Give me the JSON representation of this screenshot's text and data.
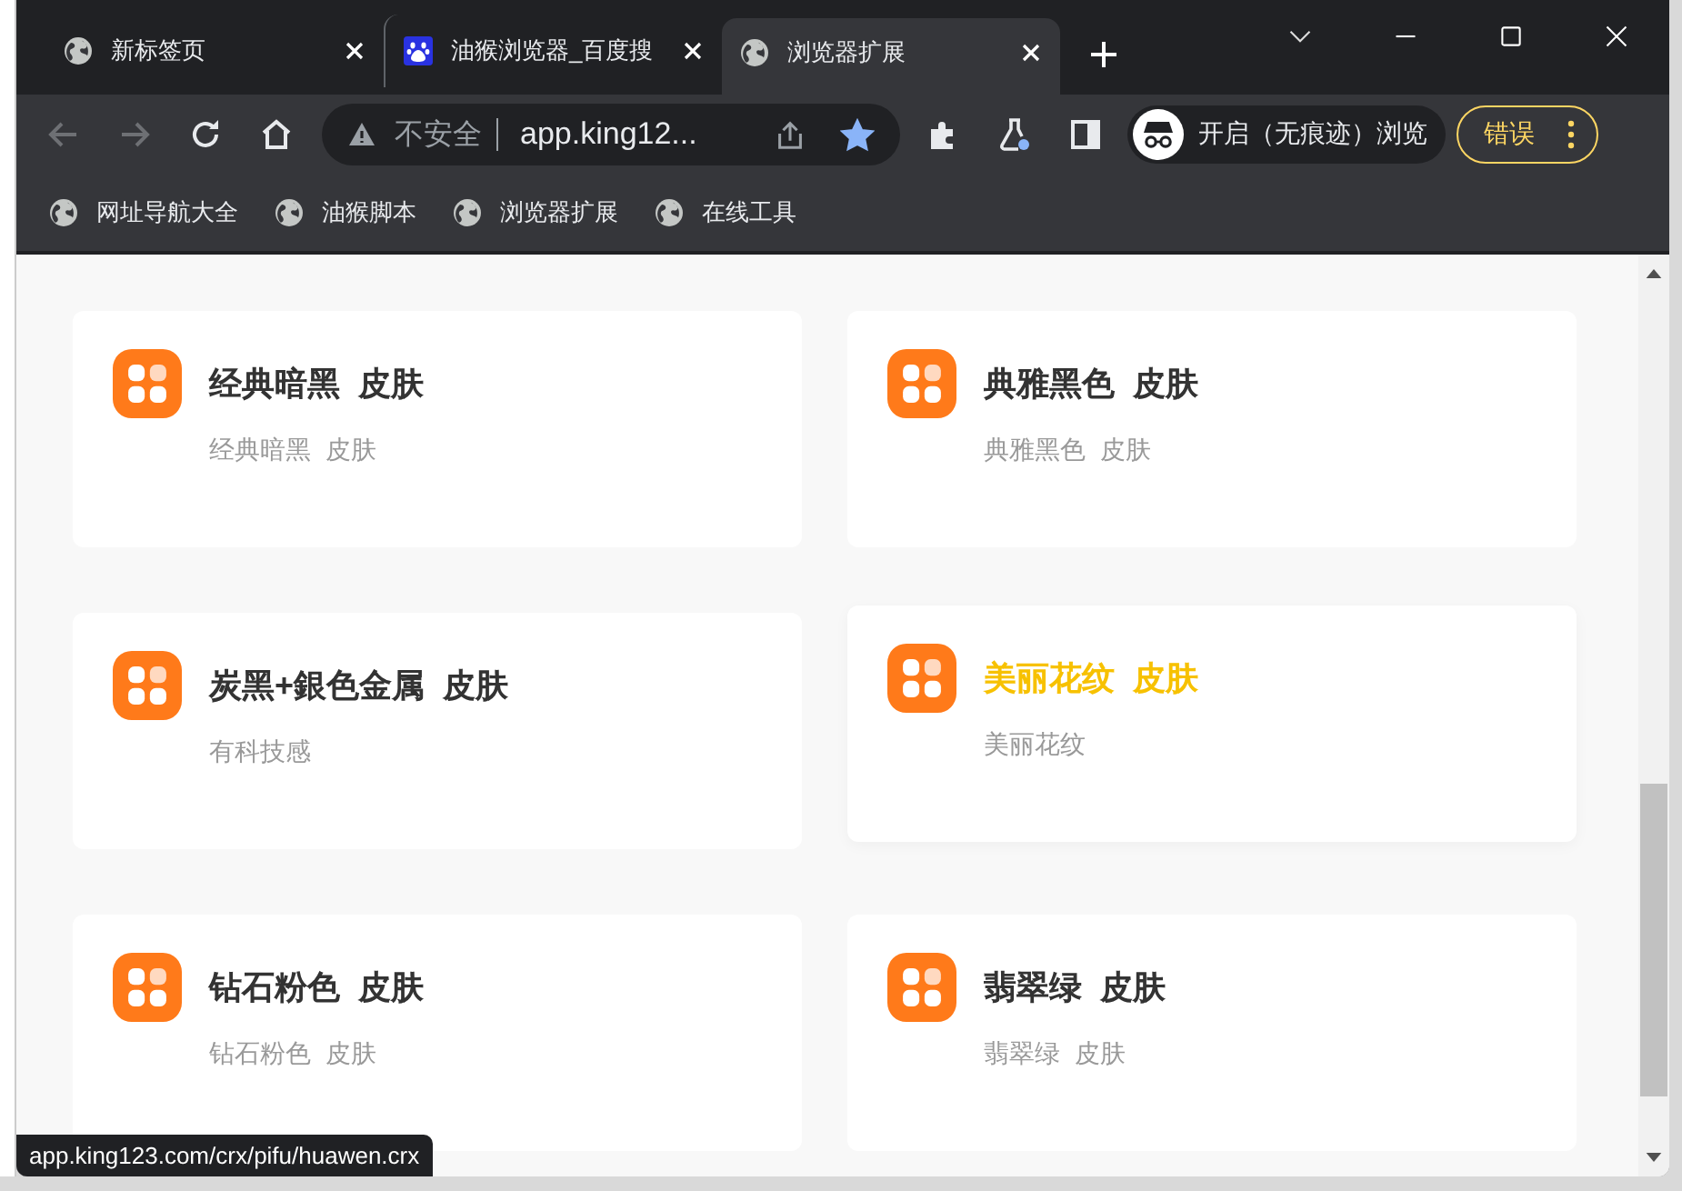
{
  "tabs": [
    {
      "title": "新标签页",
      "kind": "globe",
      "selected": false
    },
    {
      "title": "油猴浏览器_百度搜",
      "kind": "paw",
      "selected": false
    },
    {
      "title": "浏览器扩展",
      "kind": "globe",
      "selected": true
    }
  ],
  "toolbar": {
    "back_disabled": true,
    "forward_disabled": true,
    "security": "不安全",
    "url": "app.king12...",
    "bookmarked": true,
    "profile": "开启（无痕迹）浏览",
    "error_button": "错误"
  },
  "bookmarks": [
    {
      "label": "网址导航大全"
    },
    {
      "label": "油猴脚本"
    },
    {
      "label": "浏览器扩展"
    },
    {
      "label": "在线工具"
    }
  ],
  "cards": [
    {
      "title": "经典暗黑  皮肤",
      "subtitle": "经典暗黑  皮肤",
      "highlighted": false
    },
    {
      "title": "典雅黑色  皮肤",
      "subtitle": "典雅黑色  皮肤",
      "highlighted": false
    },
    {
      "title": "炭黑+銀色金属  皮肤",
      "subtitle": "有科技感",
      "highlighted": false
    },
    {
      "title": "美丽花纹  皮肤",
      "subtitle": "美丽花纹",
      "highlighted": true
    },
    {
      "title": "钻石粉色  皮肤",
      "subtitle": "钻石粉色  皮肤",
      "highlighted": false
    },
    {
      "title": "翡翠绿  皮肤",
      "subtitle": "翡翠绿  皮肤",
      "highlighted": false
    }
  ],
  "status_bar": {
    "url": "app.king123.com/crx/pifu/huawen.crx"
  }
}
